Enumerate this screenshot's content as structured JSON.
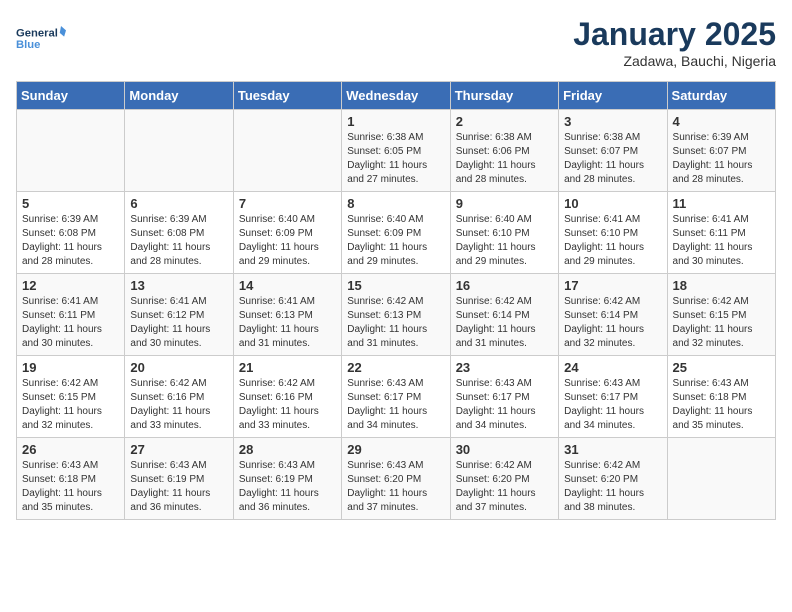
{
  "header": {
    "logo_line1": "General",
    "logo_line2": "Blue",
    "month": "January 2025",
    "location": "Zadawa, Bauchi, Nigeria"
  },
  "days_of_week": [
    "Sunday",
    "Monday",
    "Tuesday",
    "Wednesday",
    "Thursday",
    "Friday",
    "Saturday"
  ],
  "weeks": [
    [
      {
        "day": "",
        "detail": ""
      },
      {
        "day": "",
        "detail": ""
      },
      {
        "day": "",
        "detail": ""
      },
      {
        "day": "1",
        "detail": "Sunrise: 6:38 AM\nSunset: 6:05 PM\nDaylight: 11 hours\nand 27 minutes."
      },
      {
        "day": "2",
        "detail": "Sunrise: 6:38 AM\nSunset: 6:06 PM\nDaylight: 11 hours\nand 28 minutes."
      },
      {
        "day": "3",
        "detail": "Sunrise: 6:38 AM\nSunset: 6:07 PM\nDaylight: 11 hours\nand 28 minutes."
      },
      {
        "day": "4",
        "detail": "Sunrise: 6:39 AM\nSunset: 6:07 PM\nDaylight: 11 hours\nand 28 minutes."
      }
    ],
    [
      {
        "day": "5",
        "detail": "Sunrise: 6:39 AM\nSunset: 6:08 PM\nDaylight: 11 hours\nand 28 minutes."
      },
      {
        "day": "6",
        "detail": "Sunrise: 6:39 AM\nSunset: 6:08 PM\nDaylight: 11 hours\nand 28 minutes."
      },
      {
        "day": "7",
        "detail": "Sunrise: 6:40 AM\nSunset: 6:09 PM\nDaylight: 11 hours\nand 29 minutes."
      },
      {
        "day": "8",
        "detail": "Sunrise: 6:40 AM\nSunset: 6:09 PM\nDaylight: 11 hours\nand 29 minutes."
      },
      {
        "day": "9",
        "detail": "Sunrise: 6:40 AM\nSunset: 6:10 PM\nDaylight: 11 hours\nand 29 minutes."
      },
      {
        "day": "10",
        "detail": "Sunrise: 6:41 AM\nSunset: 6:10 PM\nDaylight: 11 hours\nand 29 minutes."
      },
      {
        "day": "11",
        "detail": "Sunrise: 6:41 AM\nSunset: 6:11 PM\nDaylight: 11 hours\nand 30 minutes."
      }
    ],
    [
      {
        "day": "12",
        "detail": "Sunrise: 6:41 AM\nSunset: 6:11 PM\nDaylight: 11 hours\nand 30 minutes."
      },
      {
        "day": "13",
        "detail": "Sunrise: 6:41 AM\nSunset: 6:12 PM\nDaylight: 11 hours\nand 30 minutes."
      },
      {
        "day": "14",
        "detail": "Sunrise: 6:41 AM\nSunset: 6:13 PM\nDaylight: 11 hours\nand 31 minutes."
      },
      {
        "day": "15",
        "detail": "Sunrise: 6:42 AM\nSunset: 6:13 PM\nDaylight: 11 hours\nand 31 minutes."
      },
      {
        "day": "16",
        "detail": "Sunrise: 6:42 AM\nSunset: 6:14 PM\nDaylight: 11 hours\nand 31 minutes."
      },
      {
        "day": "17",
        "detail": "Sunrise: 6:42 AM\nSunset: 6:14 PM\nDaylight: 11 hours\nand 32 minutes."
      },
      {
        "day": "18",
        "detail": "Sunrise: 6:42 AM\nSunset: 6:15 PM\nDaylight: 11 hours\nand 32 minutes."
      }
    ],
    [
      {
        "day": "19",
        "detail": "Sunrise: 6:42 AM\nSunset: 6:15 PM\nDaylight: 11 hours\nand 32 minutes."
      },
      {
        "day": "20",
        "detail": "Sunrise: 6:42 AM\nSunset: 6:16 PM\nDaylight: 11 hours\nand 33 minutes."
      },
      {
        "day": "21",
        "detail": "Sunrise: 6:42 AM\nSunset: 6:16 PM\nDaylight: 11 hours\nand 33 minutes."
      },
      {
        "day": "22",
        "detail": "Sunrise: 6:43 AM\nSunset: 6:17 PM\nDaylight: 11 hours\nand 34 minutes."
      },
      {
        "day": "23",
        "detail": "Sunrise: 6:43 AM\nSunset: 6:17 PM\nDaylight: 11 hours\nand 34 minutes."
      },
      {
        "day": "24",
        "detail": "Sunrise: 6:43 AM\nSunset: 6:17 PM\nDaylight: 11 hours\nand 34 minutes."
      },
      {
        "day": "25",
        "detail": "Sunrise: 6:43 AM\nSunset: 6:18 PM\nDaylight: 11 hours\nand 35 minutes."
      }
    ],
    [
      {
        "day": "26",
        "detail": "Sunrise: 6:43 AM\nSunset: 6:18 PM\nDaylight: 11 hours\nand 35 minutes."
      },
      {
        "day": "27",
        "detail": "Sunrise: 6:43 AM\nSunset: 6:19 PM\nDaylight: 11 hours\nand 36 minutes."
      },
      {
        "day": "28",
        "detail": "Sunrise: 6:43 AM\nSunset: 6:19 PM\nDaylight: 11 hours\nand 36 minutes."
      },
      {
        "day": "29",
        "detail": "Sunrise: 6:43 AM\nSunset: 6:20 PM\nDaylight: 11 hours\nand 37 minutes."
      },
      {
        "day": "30",
        "detail": "Sunrise: 6:42 AM\nSunset: 6:20 PM\nDaylight: 11 hours\nand 37 minutes."
      },
      {
        "day": "31",
        "detail": "Sunrise: 6:42 AM\nSunset: 6:20 PM\nDaylight: 11 hours\nand 38 minutes."
      },
      {
        "day": "",
        "detail": ""
      }
    ]
  ]
}
